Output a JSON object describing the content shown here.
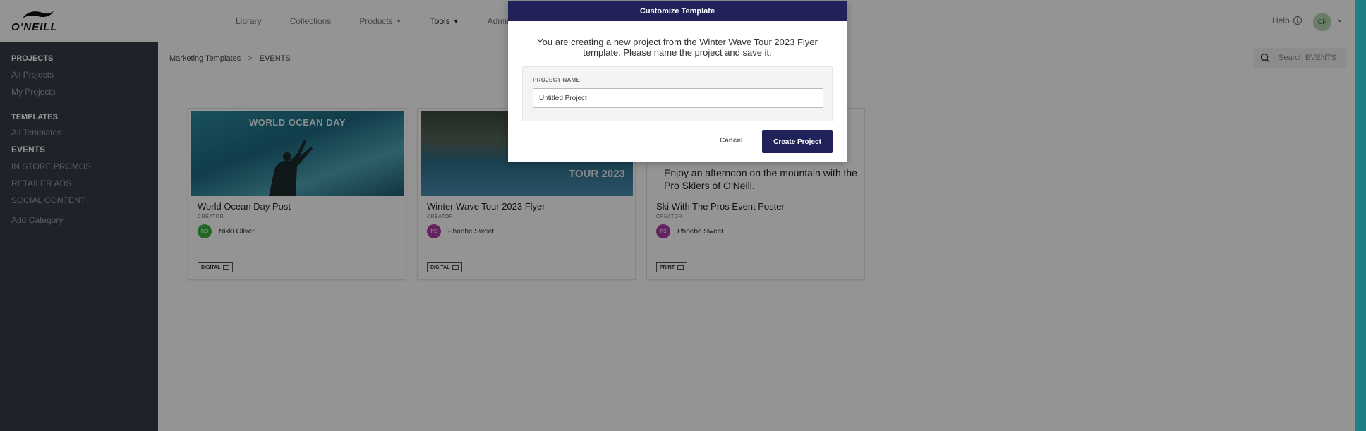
{
  "brand": {
    "logo_text": "O'NEILL"
  },
  "nav": {
    "links": [
      {
        "label": "Library"
      },
      {
        "label": "Collections"
      },
      {
        "label": "Products"
      },
      {
        "label": "Tools"
      },
      {
        "label": "Admin"
      }
    ],
    "help_label": "Help",
    "user_initials": "CP"
  },
  "sidebar": {
    "projects_heading": "PROJECTS",
    "all_projects": "All Projects",
    "my_projects": "My Projects",
    "templates_heading": "TEMPLATES",
    "all_templates": "All Templates",
    "categories": [
      {
        "label": "EVENTS"
      },
      {
        "label": "IN STORE PROMOS"
      },
      {
        "label": "RETAILER ADS"
      },
      {
        "label": "SOCIAL CONTENT"
      }
    ],
    "add_category": "Add Category"
  },
  "breadcrumb": {
    "root": "Marketing Templates",
    "separator": ">",
    "current": "EVENTS"
  },
  "search": {
    "placeholder": "Search EVENTS"
  },
  "cards": [
    {
      "title": "World Ocean Day Post",
      "image_text": "WORLD OCEAN DAY",
      "creator_label": "CREATOR",
      "creator_initials": "NO",
      "creator_name": "Nikki Oliveri",
      "creator_color": "#3cb043",
      "type": "DIGITAL"
    },
    {
      "title": "Winter Wave Tour 2023 Flyer",
      "image_text": "TOUR 2023",
      "creator_label": "CREATOR",
      "creator_initials": "PS",
      "creator_name": "Phoebe Sweet",
      "creator_color": "#b03aa8",
      "type": "DIGITAL"
    },
    {
      "title": "Ski With The Pros Event Poster",
      "image_text": "Enjoy an afternoon on the mountain with the Pro Skiers of O'Neill.",
      "creator_label": "CREATOR",
      "creator_initials": "PS",
      "creator_name": "Phoebe Sweet",
      "creator_color": "#b03aa8",
      "type": "PRINT"
    }
  ],
  "modal": {
    "title": "Customize Template",
    "message": "You are creating a new project from the Winter Wave Tour 2023 Flyer template. Please name the project and save it.",
    "field_label": "PROJECT NAME",
    "field_value": "Untitled Project",
    "cancel_label": "Cancel",
    "create_label": "Create Project"
  },
  "colors": {
    "primary": "#22225a",
    "sidebar": "#363b48",
    "scrollbar": "#1e7f87"
  }
}
